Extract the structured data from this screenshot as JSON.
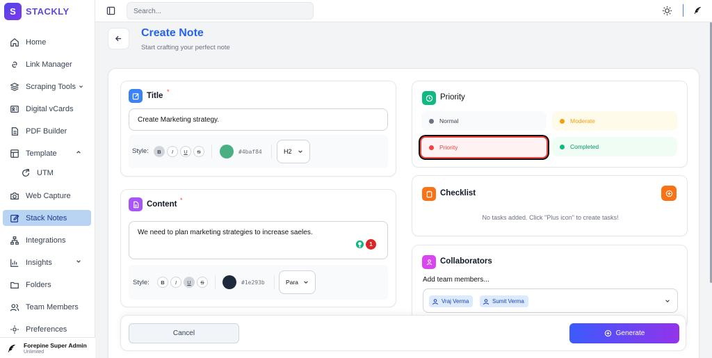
{
  "brand": {
    "logo_letter": "S",
    "name": "STACKLY"
  },
  "sidebar": {
    "items": [
      {
        "label": "Home",
        "icon": "home-icon"
      },
      {
        "label": "Link Manager",
        "icon": "link-icon"
      },
      {
        "label": "Scraping Tools",
        "icon": "layers-icon"
      },
      {
        "label": "Digital vCards",
        "icon": "id-card-icon"
      },
      {
        "label": "PDF Builder",
        "icon": "file-icon"
      },
      {
        "label": "Template",
        "icon": "template-icon"
      },
      {
        "label": "UTM",
        "icon": "utm-icon"
      },
      {
        "label": "Web Capture",
        "icon": "camera-icon"
      },
      {
        "label": "Stack Notes",
        "icon": "notes-icon"
      },
      {
        "label": "Integrations",
        "icon": "integrations-icon"
      },
      {
        "label": "Insights",
        "icon": "chart-icon"
      },
      {
        "label": "Folders",
        "icon": "folder-icon"
      },
      {
        "label": "Team Members",
        "icon": "users-icon"
      },
      {
        "label": "Preferences",
        "icon": "settings-icon"
      }
    ],
    "active": "Stack Notes",
    "user": {
      "name": "Forepine Super Admin",
      "plan": "Unlimited"
    }
  },
  "topbar": {
    "search_placeholder": "Search..."
  },
  "header": {
    "title": "Create Note",
    "subtitle": "Start crafting your perfect note"
  },
  "title_card": {
    "label": "Title",
    "required": "*",
    "value": "Create Marketing strategy.",
    "style_label": "Style:",
    "formats": [
      "B",
      "I",
      "U",
      "S"
    ],
    "color": "#4baf84",
    "color_label": "#4baf84",
    "heading": "H2"
  },
  "content_card": {
    "label": "Content",
    "required": "*",
    "value": "We need to plan marketing strategies to increase saeles.",
    "badge_count": "1",
    "style_label": "Style:",
    "formats": [
      "B",
      "I",
      "U",
      "S"
    ],
    "color": "#1e293b",
    "color_label": "#1e293b",
    "heading": "Para"
  },
  "priority_card": {
    "label": "Priority",
    "options": [
      {
        "label": "Normal",
        "color": "#6b7280"
      },
      {
        "label": "Moderate",
        "color": "#f59e0b"
      },
      {
        "label": "Priority",
        "color": "#ef4444"
      },
      {
        "label": "Completed",
        "color": "#10b981"
      }
    ],
    "selected": "Priority"
  },
  "checklist_card": {
    "label": "Checklist",
    "empty_text": "No tasks added. Click \"Plus icon\" to create tasks!"
  },
  "collaborators_card": {
    "label": "Collaborators",
    "prompt": "Add team members...",
    "members": [
      "Vraj Verma",
      "Sumit Verma"
    ]
  },
  "footer": {
    "cancel": "Cancel",
    "generate": "Generate"
  }
}
